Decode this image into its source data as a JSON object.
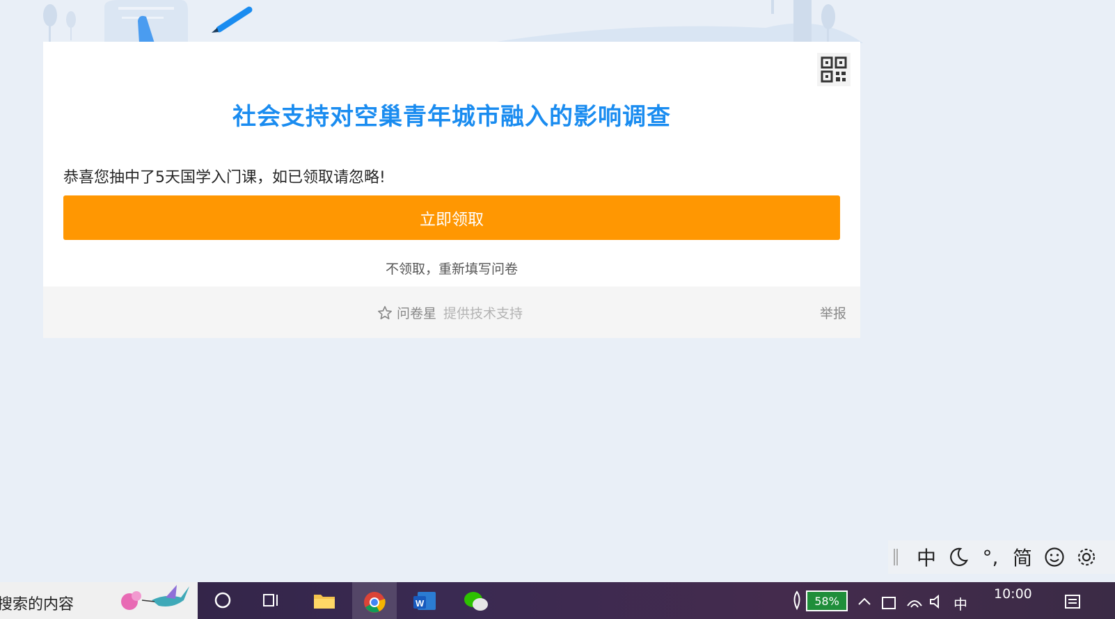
{
  "survey": {
    "title": "社会支持对空巢青年城市融入的影响调查",
    "message": "恭喜您抽中了5天国学入门课，如已领取请忽略!",
    "claim_label": "立即领取",
    "decline_label": "不领取，重新填写问卷"
  },
  "footer": {
    "brand": "问卷星",
    "support": "提供技术支持",
    "report": "举报"
  },
  "ime_bar": {
    "items": [
      {
        "label": "中",
        "icon": "chinese-mode"
      },
      {
        "label": "",
        "icon": "moon-icon"
      },
      {
        "label": "°,",
        "icon": "punctuation-icon"
      },
      {
        "label": "简",
        "icon": "simplified-icon"
      },
      {
        "label": "",
        "icon": "emoji-icon"
      },
      {
        "label": "",
        "icon": "gear-icon"
      }
    ]
  },
  "taskbar": {
    "search_placeholder": "搜索的内容",
    "battery": "58%",
    "ime_indicator": "中",
    "clock": "10:00"
  },
  "colors": {
    "title": "#1a8cf0",
    "claim_button": "#ff9702",
    "page_bg": "#e9eff7"
  }
}
